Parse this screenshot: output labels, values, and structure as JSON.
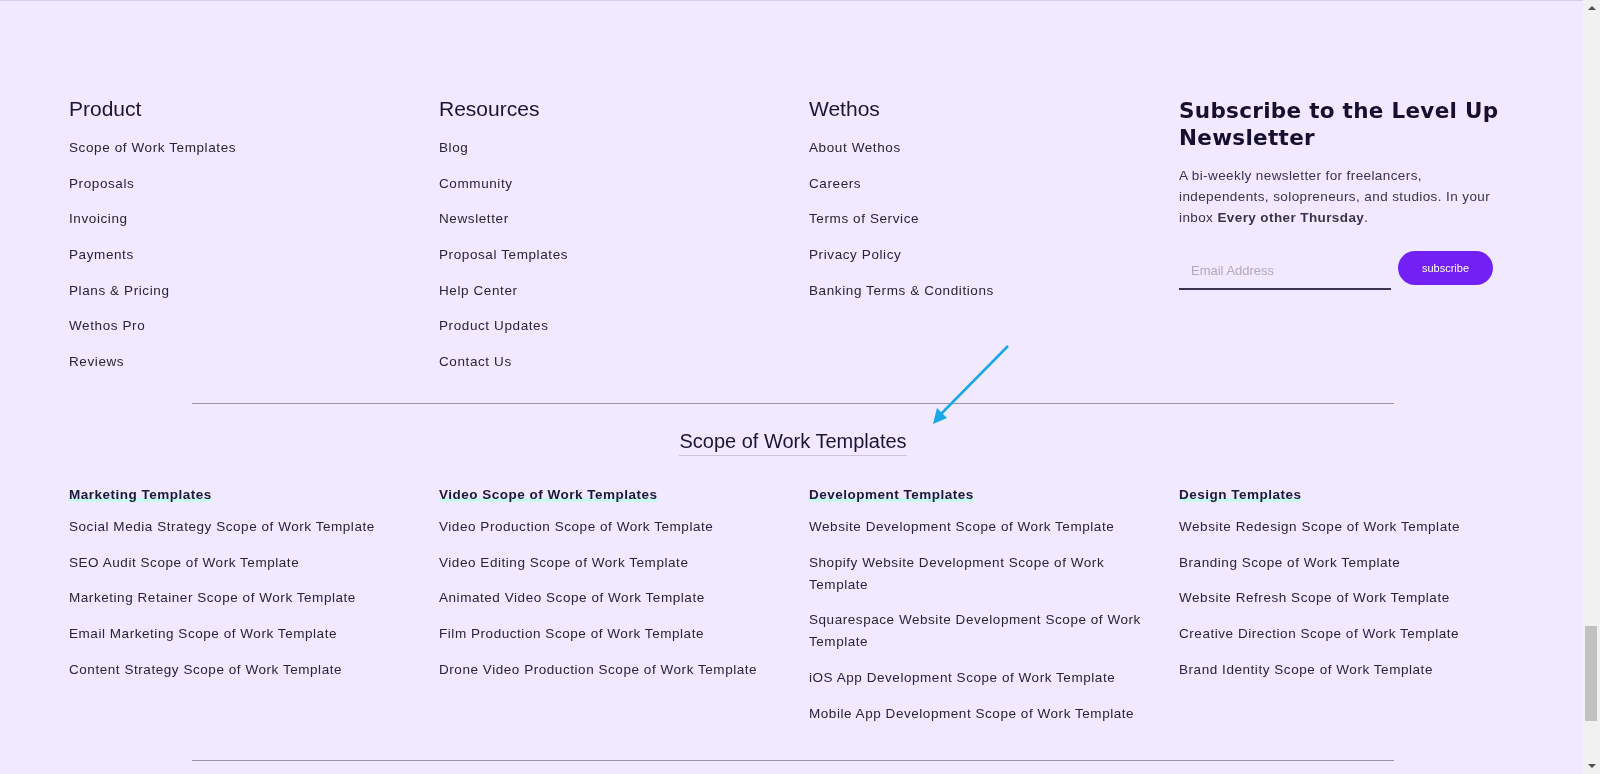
{
  "footer_columns": [
    {
      "heading": "Product",
      "links": [
        "Scope of Work Templates",
        "Proposals",
        "Invoicing",
        "Payments",
        "Plans & Pricing",
        "Wethos Pro",
        "Reviews"
      ]
    },
    {
      "heading": "Resources",
      "links": [
        "Blog",
        "Community",
        "Newsletter",
        "Proposal Templates",
        "Help Center",
        "Product Updates",
        "Contact Us"
      ]
    },
    {
      "heading": "Wethos",
      "links": [
        "About Wethos",
        "Careers",
        "Terms of Service",
        "Privacy Policy",
        "Banking Terms & Conditions"
      ]
    }
  ],
  "newsletter": {
    "title": "Subscribe to the Level Up Newsletter",
    "text": "A bi-weekly newsletter for freelancers, independents, solopreneurs, and studios. In your inbox **Every other Thursday**.",
    "email": {
      "placeholder": "Email Address"
    },
    "button": "subscribe"
  },
  "templates": {
    "title": "Scope of Work Templates",
    "columns": [
      {
        "heading": "Marketing Templates",
        "links": [
          "Social Media Strategy Scope of Work Template",
          "SEO Audit Scope of Work Template",
          "Marketing Retainer Scope of Work Template",
          "Email Marketing Scope of Work Template",
          "Content Strategy Scope of Work Template"
        ]
      },
      {
        "heading": "Video Scope of Work Templates",
        "links": [
          "Video Production Scope of Work Template",
          "Video Editing Scope of Work Template",
          "Animated Video Scope of Work Template",
          "Film Production Scope of Work Template",
          "Drone Video Production Scope of Work Template"
        ]
      },
      {
        "heading": "Development Templates",
        "links": [
          "Website Development Scope of Work Template",
          "Shopify Website Development Scope of Work Template",
          "Squarespace Website Development Scope of Work Template",
          "iOS App Development Scope of Work Template",
          "Mobile App Development Scope of Work Template"
        ]
      },
      {
        "heading": "Design Templates",
        "links": [
          "Website Redesign Scope of Work Template",
          "Branding Scope of Work Template",
          "Website Refresh Scope of Work Template",
          "Creative Direction Scope of Work Template",
          "Brand Identity Scope of Work Template"
        ]
      }
    ]
  }
}
